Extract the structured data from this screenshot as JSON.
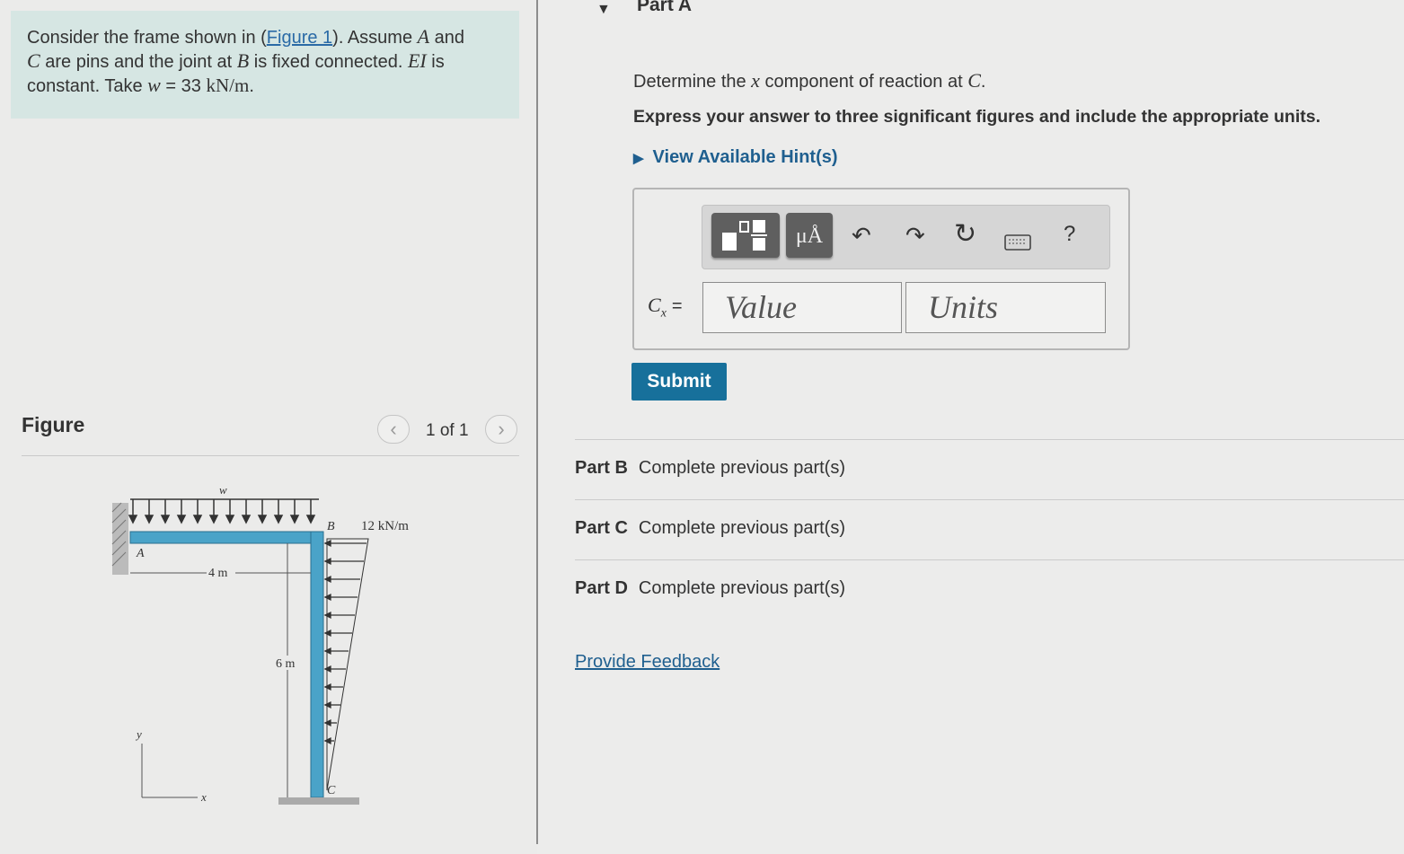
{
  "problem": {
    "line1_pre": "Consider the frame shown in (",
    "figure_link": "Figure 1",
    "line1_post": "). Assume ",
    "var_A": "A",
    "and": " and",
    "var_C": "C",
    "line2": " are pins and the joint at ",
    "var_B": "B",
    "line2_post": " is fixed connected. ",
    "var_EI": "EI",
    "is": " is",
    "line3_pre": "constant. Take ",
    "var_w": "w",
    "line3_eq": " = 33 ",
    "units": "kN/m",
    "period": "."
  },
  "figure": {
    "label": "Figure",
    "page_count": "1 of 1",
    "prev_icon": "chevron-left-icon",
    "next_icon": "chevron-right-icon",
    "labels": {
      "w": "w",
      "B": "B",
      "load": "12 kN/m",
      "A": "A",
      "span": "4 m",
      "height": "6 m",
      "C": "C",
      "y": "y",
      "x": "x"
    }
  },
  "part_a": {
    "title": "Part A",
    "question_pre": "Determine the ",
    "question_var": "x",
    "question_mid": " component of reaction at ",
    "question_C": "C",
    "question_end": ".",
    "instruction": "Express your answer to three significant figures and include the appropriate units.",
    "hints": "View Available Hint(s)",
    "answer_label": "C",
    "answer_sub": "x",
    "answer_eq": "=",
    "value_placeholder": "Value",
    "units_placeholder": "Units",
    "submit": "Submit",
    "toolbar": {
      "templates_icon": "templates-icon",
      "units_symbol": "μÅ",
      "undo_icon": "undo-icon",
      "redo_icon": "redo-icon",
      "reset_icon": "reset-icon",
      "keyboard_icon": "keyboard-icon",
      "help": "?"
    }
  },
  "parts": [
    {
      "name": "Part B",
      "status": "Complete previous part(s)"
    },
    {
      "name": "Part C",
      "status": "Complete previous part(s)"
    },
    {
      "name": "Part D",
      "status": "Complete previous part(s)"
    }
  ],
  "feedback": "Provide Feedback",
  "colors": {
    "problem_bg": "#d6e6e3",
    "submit_bg": "#17709b",
    "link": "#1f5f8f",
    "frame_member": "#4aa3c8"
  }
}
